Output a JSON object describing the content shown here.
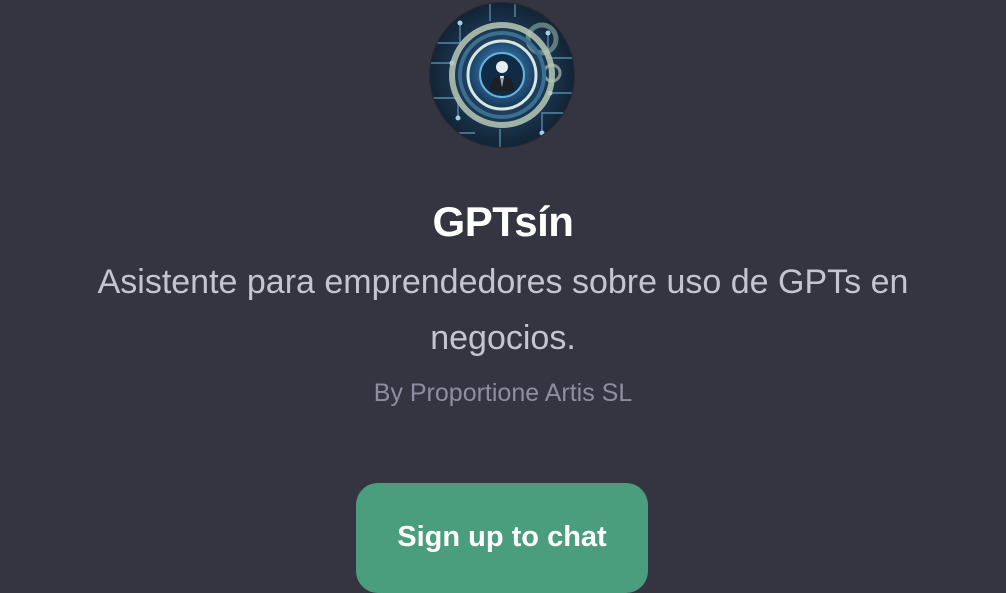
{
  "gpt": {
    "name": "GPTsín",
    "description": "Asistente para emprendedores sobre uso de GPTs en negocios.",
    "author": "By Proportione Artis SL",
    "avatar_icon": "business-person-circuit-avatar"
  },
  "actions": {
    "signup_label": "Sign up to chat"
  },
  "colors": {
    "background": "#343541",
    "title": "#ffffff",
    "description": "#c5c5d2",
    "author": "#8e8ea0",
    "button": "#4a9d7d"
  }
}
